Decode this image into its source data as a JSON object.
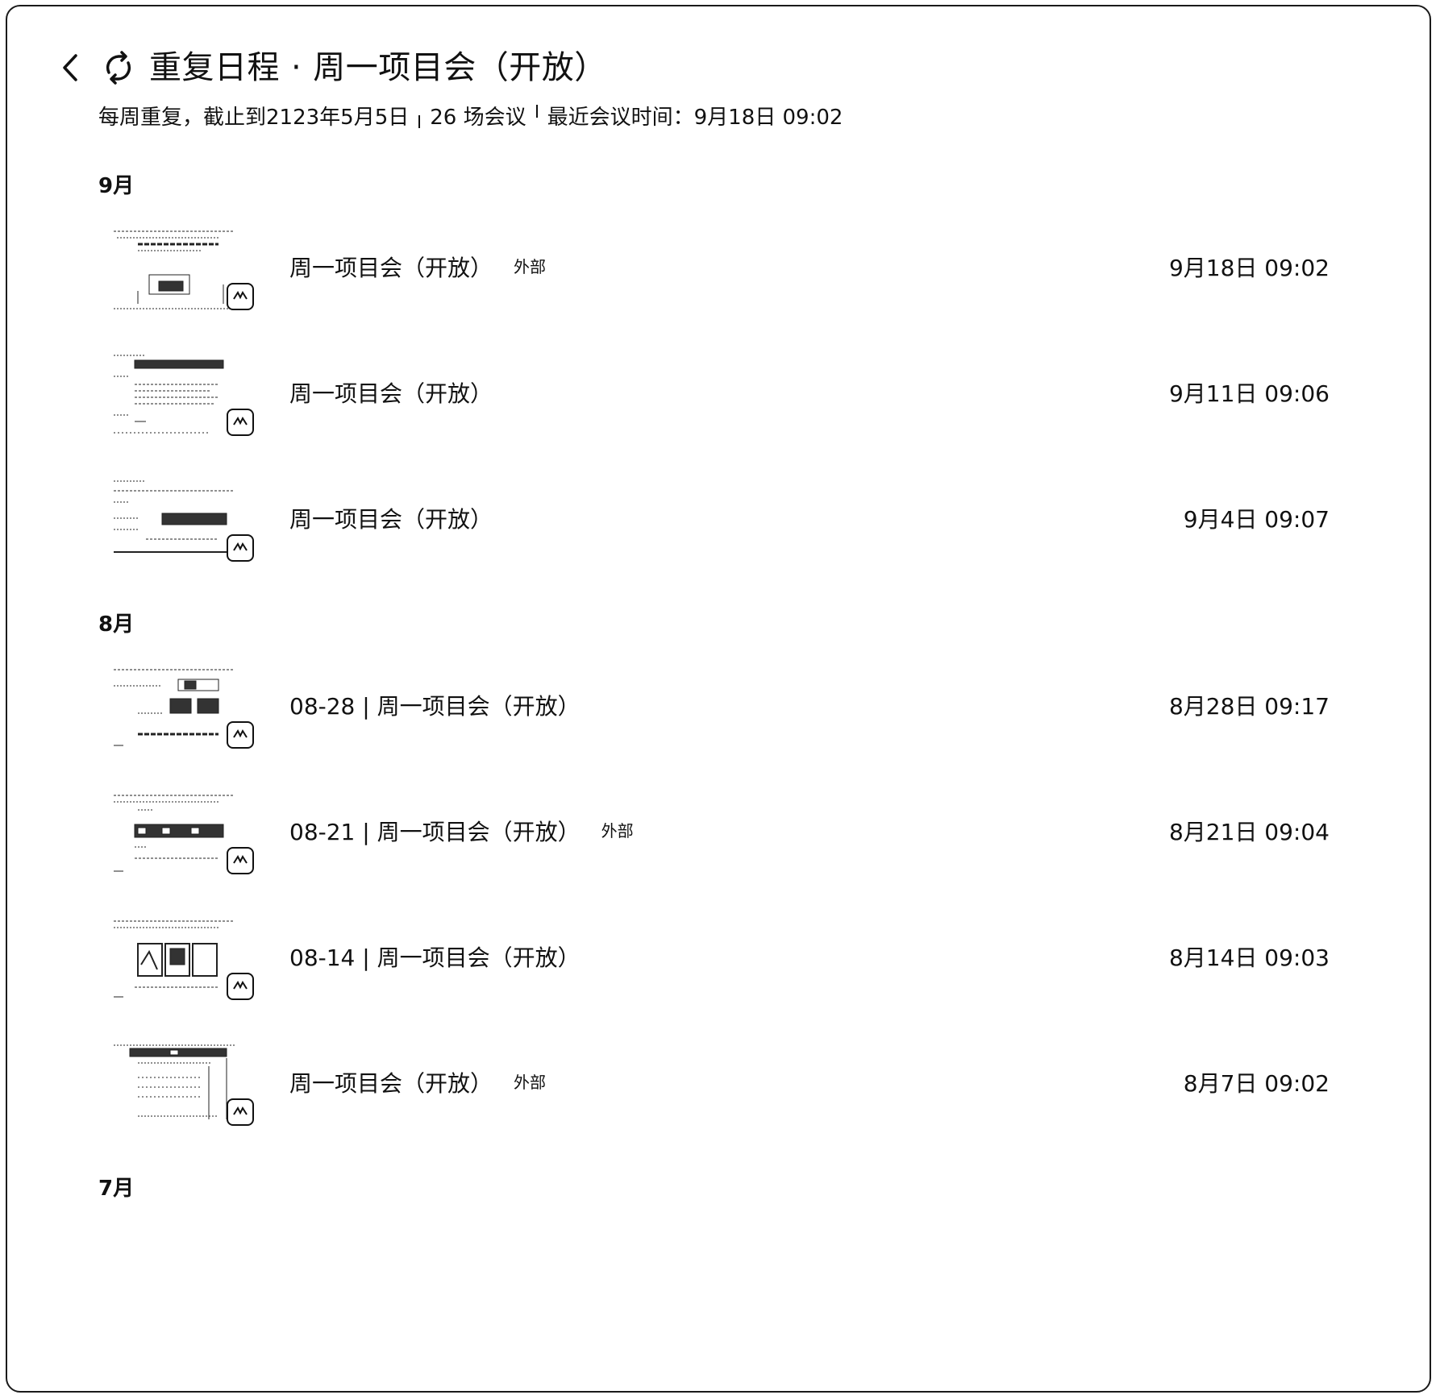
{
  "header": {
    "back_icon": "chevron-left-icon",
    "repeat_icon": "repeat-icon",
    "title_schedule": "重复日程",
    "title_separator": "·",
    "title_meeting": "周一项目会（开放）",
    "meta_recurrence": "每周重复，截止到2123年5月5日",
    "meta_count": "26 场会议",
    "meta_latest": "最近会议时间：9月18日 09:02"
  },
  "groups": [
    {
      "month": "9月",
      "items": [
        {
          "title": "周一项目会（开放）",
          "tag": "外部",
          "time": "9月18日 09:02"
        },
        {
          "title": "周一项目会（开放）",
          "tag": "",
          "time": "9月11日 09:06"
        },
        {
          "title": "周一项目会（开放）",
          "tag": "",
          "time": "9月4日 09:07"
        }
      ]
    },
    {
      "month": "8月",
      "items": [
        {
          "title": "08-28 | 周一项目会（开放）",
          "tag": "",
          "time": "8月28日 09:17"
        },
        {
          "title": "08-21 | 周一项目会（开放）",
          "tag": "外部",
          "time": "8月21日 09:04"
        },
        {
          "title": "08-14 | 周一项目会（开放）",
          "tag": "",
          "time": "8月14日 09:03"
        },
        {
          "title": "周一项目会（开放）",
          "tag": "外部",
          "time": "8月7日 09:02"
        }
      ]
    },
    {
      "month": "7月",
      "items": []
    }
  ],
  "colors": {
    "text": "#111111",
    "border": "#1a1a1a",
    "background": "#ffffff"
  }
}
